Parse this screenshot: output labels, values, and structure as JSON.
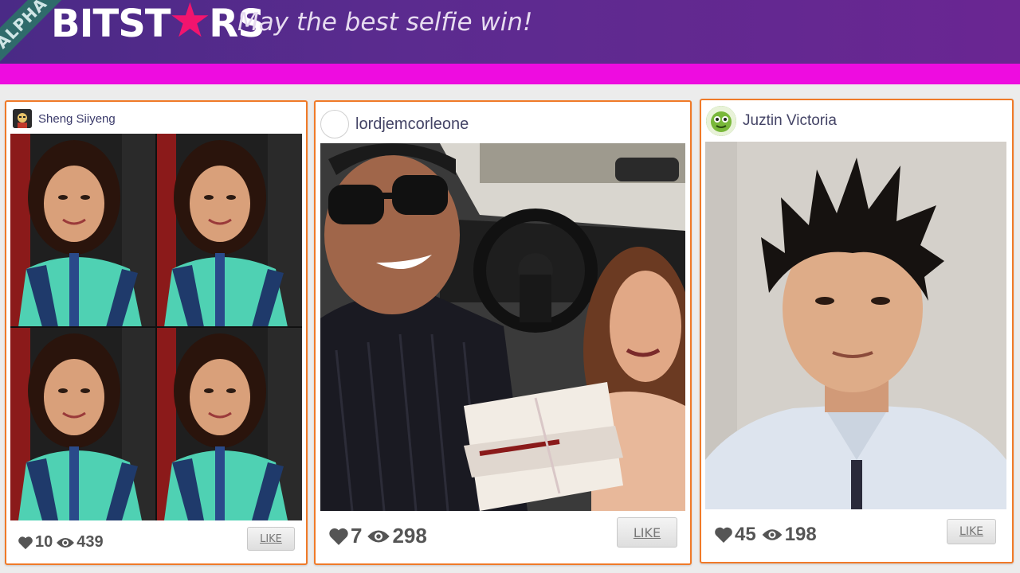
{
  "header": {
    "badge": "ALPHA",
    "logo_left": "BITST",
    "logo_star": "★",
    "logo_right": "RS",
    "tagline": "May the best selfie win!"
  },
  "colors": {
    "header_start": "#4a2a86",
    "header_end": "#6a2692",
    "magenta_bar": "#ee0ce0",
    "star": "#f2146e",
    "card_border": "#f07a28"
  },
  "cards": [
    {
      "username": "Sheng Siiyeng",
      "likes": "10",
      "views": "439",
      "like_label": "LIKE",
      "avatar_icon": "user-avatar-icon"
    },
    {
      "username": "lordjemcorleone",
      "likes": "7",
      "views": "298",
      "like_label": "LIKE",
      "avatar_icon": "empty-avatar-icon"
    },
    {
      "username": "Juztin Victoria",
      "likes": "45",
      "views": "198",
      "like_label": "LIKE",
      "avatar_icon": "user-avatar-icon"
    }
  ]
}
